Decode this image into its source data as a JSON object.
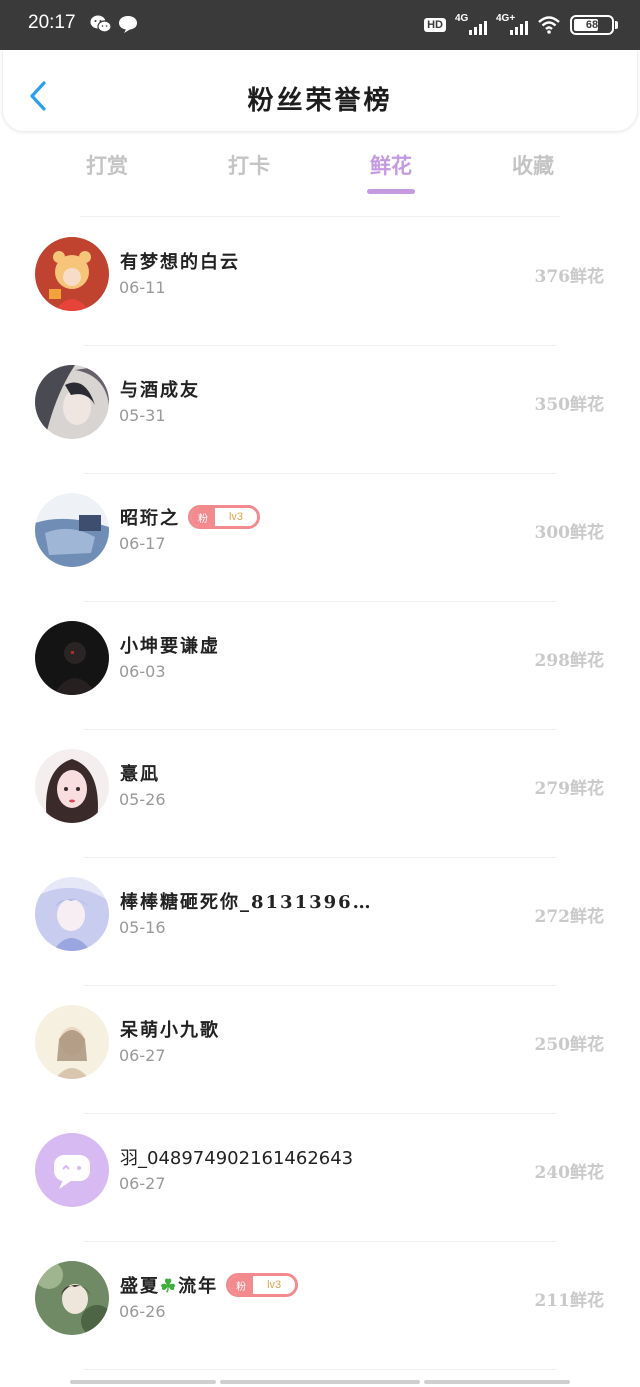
{
  "status_bar": {
    "time": "20:17",
    "hd": "HD",
    "net1": "4G",
    "net2": "4G+",
    "battery": "68",
    "battery_level": 0.68
  },
  "header": {
    "title": "粉丝荣誉榜"
  },
  "tabs": [
    {
      "label": "打赏",
      "active": false
    },
    {
      "label": "打卡",
      "active": false
    },
    {
      "label": "鲜花",
      "active": true
    },
    {
      "label": "收藏",
      "active": false
    }
  ],
  "colors": {
    "accent": "#c49ae0",
    "back_arrow": "#2a9ff0",
    "badge": "#f28a8e"
  },
  "fans": [
    {
      "name": "有梦想的白云",
      "date": "06-11",
      "amount": "376鲜花",
      "badge": null,
      "avatar": "avatar-tiger"
    },
    {
      "name": "与酒成友",
      "date": "05-31",
      "amount": "350鲜花",
      "badge": null,
      "avatar": "avatar-ink"
    },
    {
      "name": "昭珩之",
      "date": "06-17",
      "amount": "300鲜花",
      "badge": {
        "left": "粉",
        "right": "lv3"
      },
      "avatar": "avatar-sky"
    },
    {
      "name": "小坤要谦虚",
      "date": "06-03",
      "amount": "298鲜花",
      "badge": null,
      "avatar": "avatar-dark"
    },
    {
      "name": "憙凪",
      "date": "05-26",
      "amount": "279鲜花",
      "badge": null,
      "avatar": "avatar-girl"
    },
    {
      "name": "棒棒糖砸死你_8131396…",
      "date": "05-16",
      "amount": "272鲜花",
      "badge": null,
      "avatar": "avatar-anime"
    },
    {
      "name": "呆萌小九歌",
      "date": "06-27",
      "amount": "250鲜花",
      "badge": null,
      "avatar": "avatar-sketch"
    },
    {
      "name": "羽_048974902161462643",
      "date": "06-27",
      "amount": "240鲜花",
      "badge": null,
      "avatar": "avatar-chat"
    },
    {
      "name_before": "盛夏",
      "name_icon": "☘",
      "name_after": "流年",
      "name": "盛夏☘流年",
      "date": "06-26",
      "amount": "211鲜花",
      "badge": {
        "left": "粉",
        "right": "lv3"
      },
      "avatar": "avatar-nature"
    }
  ]
}
